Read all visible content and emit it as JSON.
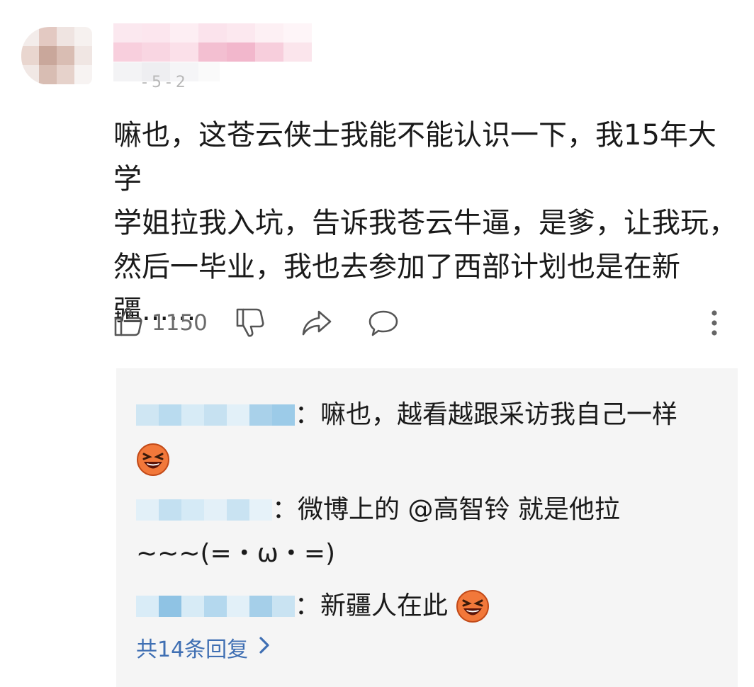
{
  "comment": {
    "date_partial": "-5-2",
    "text": "嘛也，这苍云侠士我能不能认识一下，我15年大学\n学姐拉我入坑，告诉我苍云牛逼，是爹，让我玩，\n然后一毕业，我也去参加了西部计划也是在新\n疆......",
    "like_count": "1150"
  },
  "icons": {
    "like": "thumbs-up-icon",
    "dislike": "thumbs-down-icon",
    "share": "share-arrow-icon",
    "reply": "speech-bubble-icon",
    "more": "vertical-dots-icon",
    "emoji": "laughing-face-emoji"
  },
  "replies": [
    {
      "text": "：嘛也，越看越跟采访我自己一样"
    },
    {
      "text": "：微博上的 @高智铃 就是他拉",
      "text_line2": "~~~(=・ω・=)"
    },
    {
      "text": "：新疆人在此"
    }
  ],
  "more_replies_label": "共14条回复",
  "colors": {
    "link": "#3f6fb3",
    "reply_bg": "#f5f5f5",
    "icon": "#555555"
  }
}
